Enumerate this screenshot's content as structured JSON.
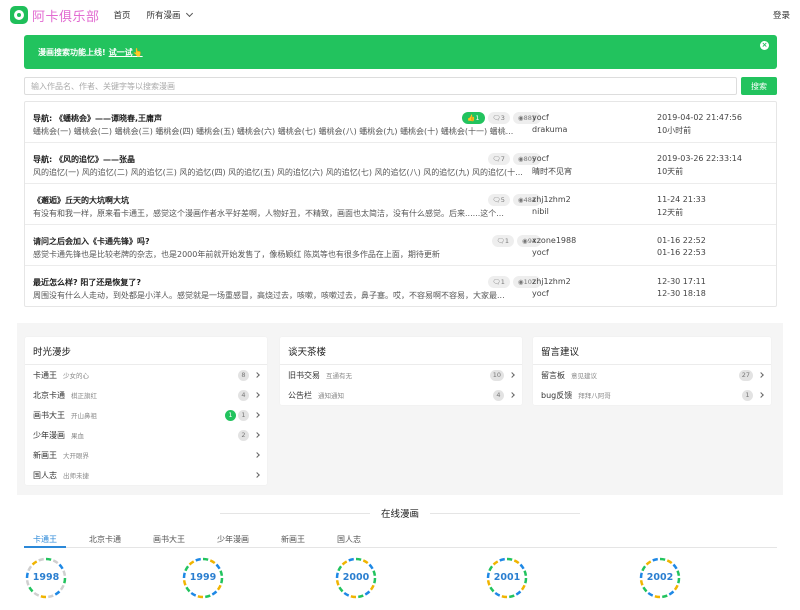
{
  "nav": {
    "logo_text": "阿卡俱乐部",
    "home": "首页",
    "all_comics": "所有漫画",
    "login": "登录"
  },
  "alert": {
    "text": "漫画搜索功能上线!",
    "link": "试一试",
    "link_emoji": "👆",
    "close": "×"
  },
  "search": {
    "placeholder": "输入作品名、作者、关键字等以搜索漫画",
    "button": "搜索"
  },
  "threads": [
    {
      "title": "导航: 《蟠桃会》——谭晓春,王庸声",
      "excerpt": "蟠桃会(一) 蟠桃会(二) 蟠桃会(三) 蟠桃会(四) 蟠桃会(五) 蟠桃会(六) 蟠桃会(七) 蟠桃会(八) 蟠桃会(九) 蟠桃会(十) 蟠桃会(十一) 蟠桃...",
      "likes": "1",
      "comments": "3",
      "views": "881",
      "author": "yocf",
      "last_user": "drakuma",
      "created": "2019-04-02 21:47:56",
      "last_time": "10小时前"
    },
    {
      "title": "导航: 《风的追忆》——张晶",
      "excerpt": "风的追忆(一) 风的追忆(二) 风的追忆(三) 风的追忆(四) 风的追忆(五) 风的追忆(六) 风的追忆(七) 风的追忆(八) 风的追忆(九) 风的追忆(十...",
      "likes": "",
      "comments": "7",
      "views": "805",
      "author": "yocf",
      "last_user": "晴时不见宵",
      "created": "2019-03-26 22:33:14",
      "last_time": "10天前"
    },
    {
      "title": "《邂逅》丘天的大坑啊大坑",
      "excerpt": "有没有和我一样，原来看卡通王，感觉这个漫画作者水平好差啊，人物好丑，不精致，画面也太简洁，没有什么感觉。后来......这个...",
      "likes": "",
      "comments": "5",
      "views": "484",
      "author": "zhj1zhm2",
      "last_user": "nibil",
      "created": "11-24 21:33",
      "last_time": "12天前"
    },
    {
      "title": "请问之后会加入《卡通先锋》吗?",
      "excerpt": "感觉卡通先锋也是比较老牌的杂志，也是2000年前就开始发售了，像杨颖红 陈岚等也有很多作品在上面，期待更新",
      "likes": "",
      "comments": "1",
      "views": "94",
      "author": "xzone1988",
      "last_user": "yocf",
      "created": "01-16 22:52",
      "last_time": "01-16 22:53"
    },
    {
      "title": "最近怎么样? 阳了还是恢复了?",
      "excerpt": "周围没有什么人走动，到处都是小洋人。感觉就是一场重感冒，高烧过去，咳嗽，咳嗽过去，鼻子塞。哎，不容易啊不容易，大家最...",
      "likes": "",
      "comments": "1",
      "views": "102",
      "author": "zhj1zhm2",
      "last_user": "yocf",
      "created": "12-30 17:11",
      "last_time": "12-30 18:18"
    }
  ],
  "forums": [
    {
      "name": "时光漫步",
      "items": [
        {
          "name": "卡通王",
          "desc": "少女的心",
          "new": "",
          "count": "8"
        },
        {
          "name": "北京卡通",
          "desc": "棋正旗红",
          "new": "",
          "count": "4"
        },
        {
          "name": "画书大王",
          "desc": "开山鼻祖",
          "new": "1",
          "count": "1"
        },
        {
          "name": "少年漫画",
          "desc": "果血",
          "new": "",
          "count": "2"
        },
        {
          "name": "新画王",
          "desc": "大开眼界",
          "new": "",
          "count": ""
        },
        {
          "name": "国人志",
          "desc": "出师未捷",
          "new": "",
          "count": ""
        }
      ]
    },
    {
      "name": "谈天茶楼",
      "items": [
        {
          "name": "旧书交易",
          "desc": "互通有无",
          "new": "",
          "count": "10"
        },
        {
          "name": "公告栏",
          "desc": "通知通知",
          "new": "",
          "count": "4"
        }
      ]
    },
    {
      "name": "留言建议",
      "items": [
        {
          "name": "留言板",
          "desc": "意见建议",
          "new": "",
          "count": "27"
        },
        {
          "name": "bug反馈",
          "desc": "拜拜八阿哥",
          "new": "",
          "count": "1"
        }
      ]
    }
  ],
  "online": {
    "title": "在线漫画",
    "tabs": [
      "卡通王",
      "北京卡通",
      "画书大王",
      "少年漫画",
      "新画王",
      "国人志"
    ],
    "active_tab": 0,
    "years": [
      "1998",
      "1999",
      "2000",
      "2001",
      "2002"
    ]
  },
  "colors": {
    "accent_green": "#22c35e",
    "link_blue": "#2b88d8",
    "logo_pink": "#e26bd1"
  }
}
